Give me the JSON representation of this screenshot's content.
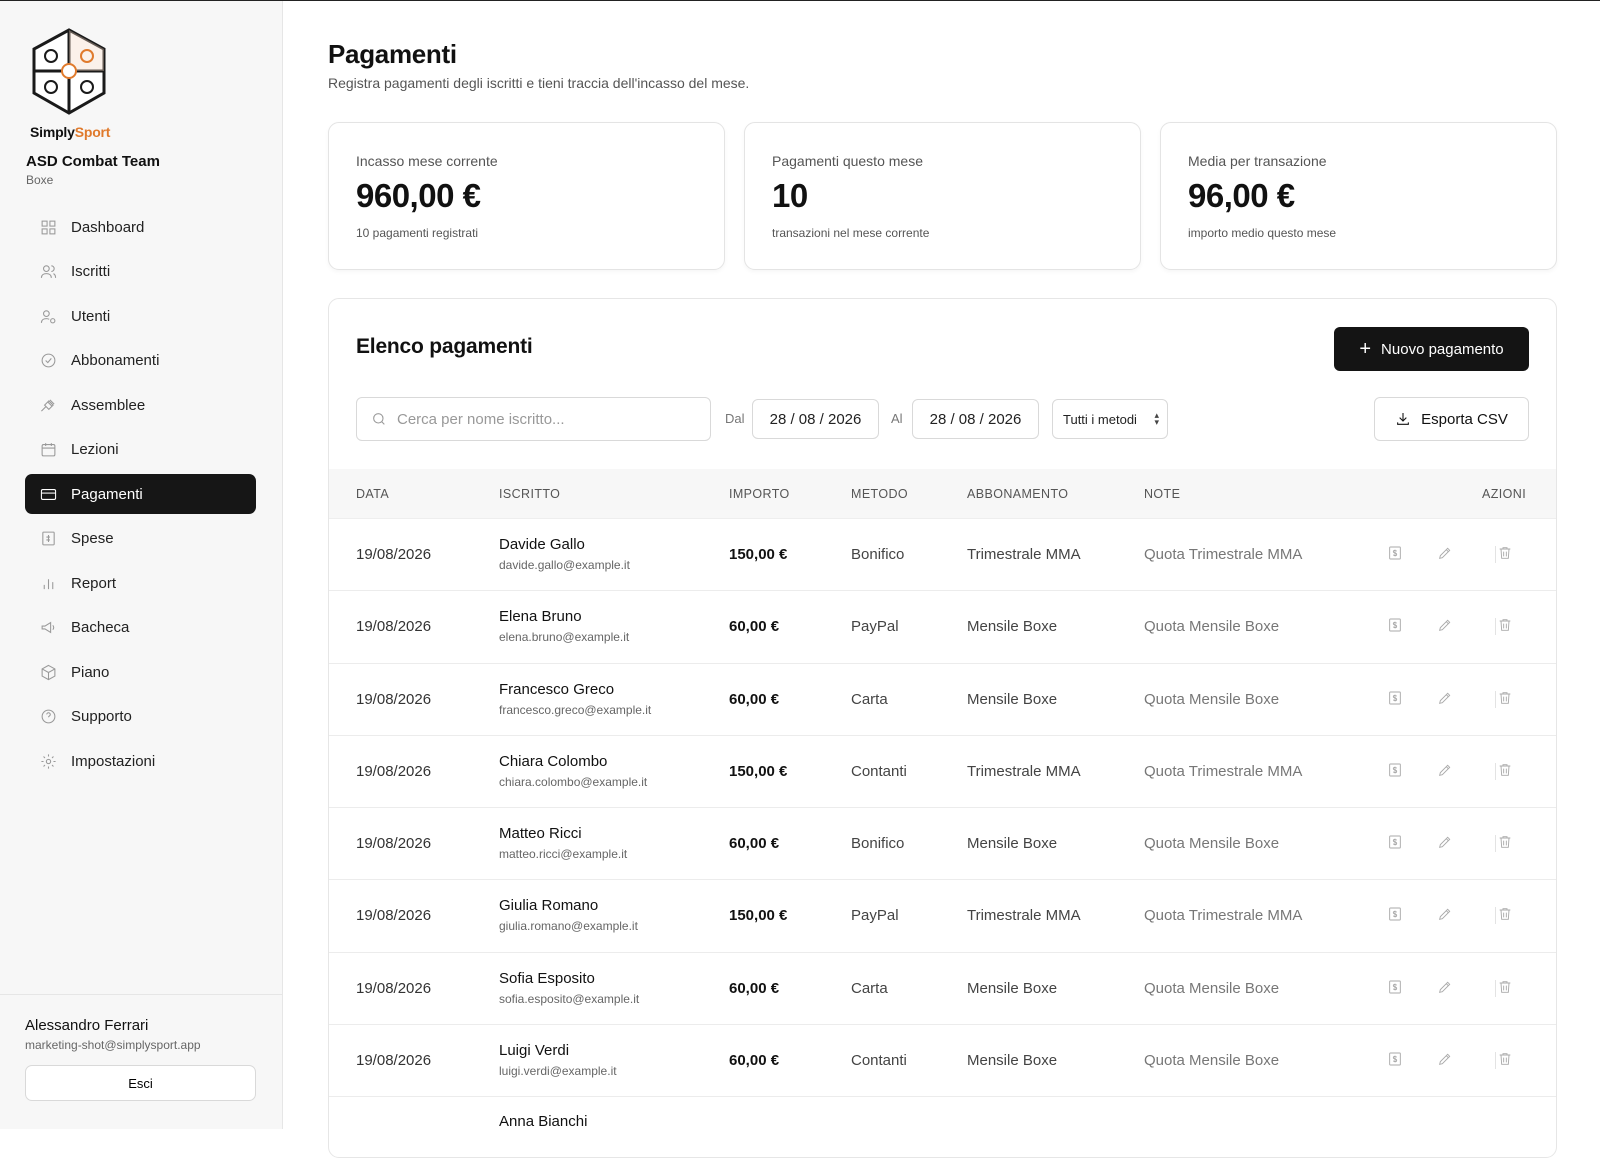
{
  "brand": {
    "logo_text_a": "Simply",
    "logo_text_b": "Sport",
    "accent": "#e07a2c"
  },
  "org": {
    "name": "ASD Combat Team",
    "sport": "Boxe"
  },
  "sidebar": {
    "items": [
      {
        "label": "Dashboard",
        "icon": "grid-icon"
      },
      {
        "label": "Iscritti",
        "icon": "users-icon"
      },
      {
        "label": "Utenti",
        "icon": "user-cog-icon"
      },
      {
        "label": "Abbonamenti",
        "icon": "check-circle-icon"
      },
      {
        "label": "Assemblee",
        "icon": "gavel-icon"
      },
      {
        "label": "Lezioni",
        "icon": "calendar-icon"
      },
      {
        "label": "Pagamenti",
        "icon": "credit-card-icon",
        "active": true
      },
      {
        "label": "Spese",
        "icon": "receipt-icon"
      },
      {
        "label": "Report",
        "icon": "bar-chart-icon"
      },
      {
        "label": "Bacheca",
        "icon": "megaphone-icon"
      },
      {
        "label": "Piano",
        "icon": "box-icon"
      },
      {
        "label": "Supporto",
        "icon": "help-circle-icon"
      },
      {
        "label": "Impostazioni",
        "icon": "gear-icon"
      }
    ]
  },
  "user": {
    "name": "Alessandro Ferrari",
    "email": "marketing-shot@simplysport.app",
    "logout_label": "Esci"
  },
  "page": {
    "title": "Pagamenti",
    "subtitle": "Registra pagamenti degli iscritti e tieni traccia dell'incasso del mese."
  },
  "stats": [
    {
      "label": "Incasso mese corrente",
      "value": "960,00 €",
      "desc": "10 pagamenti registrati"
    },
    {
      "label": "Pagamenti questo mese",
      "value": "10",
      "desc": "transazioni nel mese corrente"
    },
    {
      "label": "Media per transazione",
      "value": "96,00 €",
      "desc": "importo medio questo mese"
    }
  ],
  "panel": {
    "title": "Elenco pagamenti",
    "new_button": "Nuovo pagamento",
    "search_placeholder": "Cerca per nome iscritto...",
    "from_label": "Dal",
    "from_date": "28 / 08 / 2026",
    "to_label": "Al",
    "to_date": "28 / 08 / 2026",
    "method_filter": "Tutti i metodi",
    "export_label": "Esporta CSV"
  },
  "table": {
    "headers": [
      "DATA",
      "ISCRITTO",
      "IMPORTO",
      "METODO",
      "ABBONAMENTO",
      "NOTE",
      "AZIONI"
    ],
    "rows": [
      {
        "date": "19/08/2026",
        "name": "Davide Gallo",
        "email": "davide.gallo@example.it",
        "amount": "150,00 €",
        "method": "Bonifico",
        "subscription": "Trimestrale MMA",
        "note": "Quota Trimestrale MMA"
      },
      {
        "date": "19/08/2026",
        "name": "Elena Bruno",
        "email": "elena.bruno@example.it",
        "amount": "60,00 €",
        "method": "PayPal",
        "subscription": "Mensile Boxe",
        "note": "Quota Mensile Boxe"
      },
      {
        "date": "19/08/2026",
        "name": "Francesco Greco",
        "email": "francesco.greco@example.it",
        "amount": "60,00 €",
        "method": "Carta",
        "subscription": "Mensile Boxe",
        "note": "Quota Mensile Boxe"
      },
      {
        "date": "19/08/2026",
        "name": "Chiara Colombo",
        "email": "chiara.colombo@example.it",
        "amount": "150,00 €",
        "method": "Contanti",
        "subscription": "Trimestrale MMA",
        "note": "Quota Trimestrale MMA"
      },
      {
        "date": "19/08/2026",
        "name": "Matteo Ricci",
        "email": "matteo.ricci@example.it",
        "amount": "60,00 €",
        "method": "Bonifico",
        "subscription": "Mensile Boxe",
        "note": "Quota Mensile Boxe"
      },
      {
        "date": "19/08/2026",
        "name": "Giulia Romano",
        "email": "giulia.romano@example.it",
        "amount": "150,00 €",
        "method": "PayPal",
        "subscription": "Trimestrale MMA",
        "note": "Quota Trimestrale MMA"
      },
      {
        "date": "19/08/2026",
        "name": "Sofia Esposito",
        "email": "sofia.esposito@example.it",
        "amount": "60,00 €",
        "method": "Carta",
        "subscription": "Mensile Boxe",
        "note": "Quota Mensile Boxe"
      },
      {
        "date": "19/08/2026",
        "name": "Luigi Verdi",
        "email": "luigi.verdi@example.it",
        "amount": "60,00 €",
        "method": "Contanti",
        "subscription": "Mensile Boxe",
        "note": "Quota Mensile Boxe"
      },
      {
        "name": "Anna Bianchi"
      }
    ]
  }
}
